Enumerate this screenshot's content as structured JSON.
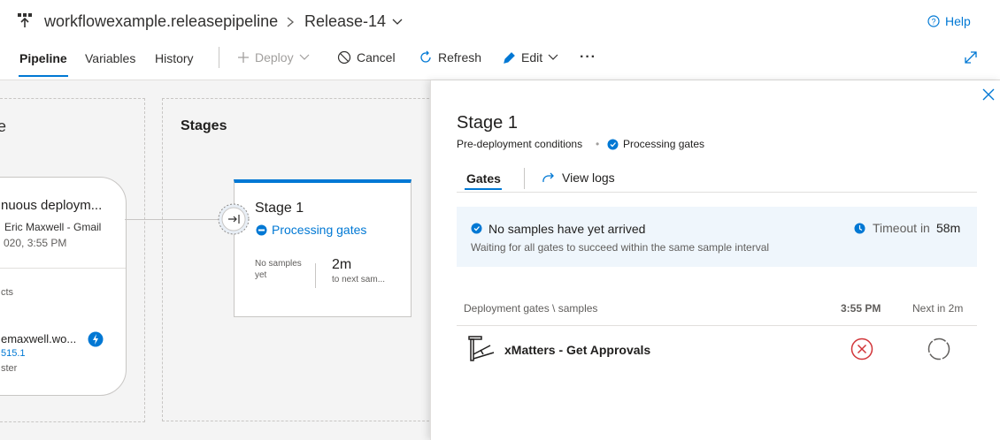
{
  "header": {
    "pipeline_name": "workflowexample.releasepipeline",
    "separator": ">",
    "release_name": "Release-14",
    "help_label": "Help",
    "tabs": [
      {
        "label": "Pipeline",
        "active": true
      },
      {
        "label": "Variables",
        "active": false
      },
      {
        "label": "History",
        "active": false
      }
    ],
    "toolbar": {
      "deploy_label": "Deploy",
      "cancel_label": "Cancel",
      "refresh_label": "Refresh",
      "edit_label": "Edit",
      "more_label": "···"
    }
  },
  "canvas": {
    "artifact_card": {
      "title": "nuous deploym...",
      "author": "Eric Maxwell - Gmail",
      "date": "020, 3:55 PM",
      "section_label": "cts",
      "artifact_name": "emaxwell.wo...",
      "artifact_version": "515.1",
      "artifact_branch": "ster"
    },
    "stages_label": "Stages",
    "stage_card": {
      "name": "Stage 1",
      "status": "Processing gates",
      "samples_text": "No samples yet",
      "time_value": "2m",
      "time_caption": "to next sam..."
    }
  },
  "panel": {
    "title": "Stage 1",
    "subtitle_left": "Pre-deployment conditions",
    "subtitle_dot": "•",
    "subtitle_status": "Processing gates",
    "tabs": {
      "gates_label": "Gates",
      "view_logs_label": "View logs"
    },
    "info": {
      "title": "No samples have yet arrived",
      "description": "Waiting for all gates to succeed within the same sample interval",
      "timeout_label": "Timeout in",
      "timeout_value": "58m"
    },
    "table": {
      "header_label": "Deployment gates \\ samples",
      "col_time": "3:55 PM",
      "col_next": "Next in 2m",
      "rows": [
        {
          "name": "xMatters - Get Approvals",
          "sample_status": "failed",
          "next_status": "pending"
        }
      ]
    }
  },
  "colors": {
    "accent": "#0078d4",
    "error": "#d13438",
    "info_bg": "#eff6fc"
  },
  "icons": [
    "pipeline-icon",
    "chevron-right-icon",
    "chevron-down-icon",
    "help-icon",
    "plus-icon",
    "cancel-icon",
    "refresh-icon",
    "pencil-icon",
    "expand-icon",
    "close-icon",
    "gate-icon",
    "status-icon",
    "lightning-icon",
    "link-arrow-icon",
    "clock-icon",
    "xmatters-icon",
    "error-circle-icon",
    "pending-circle-icon"
  ]
}
